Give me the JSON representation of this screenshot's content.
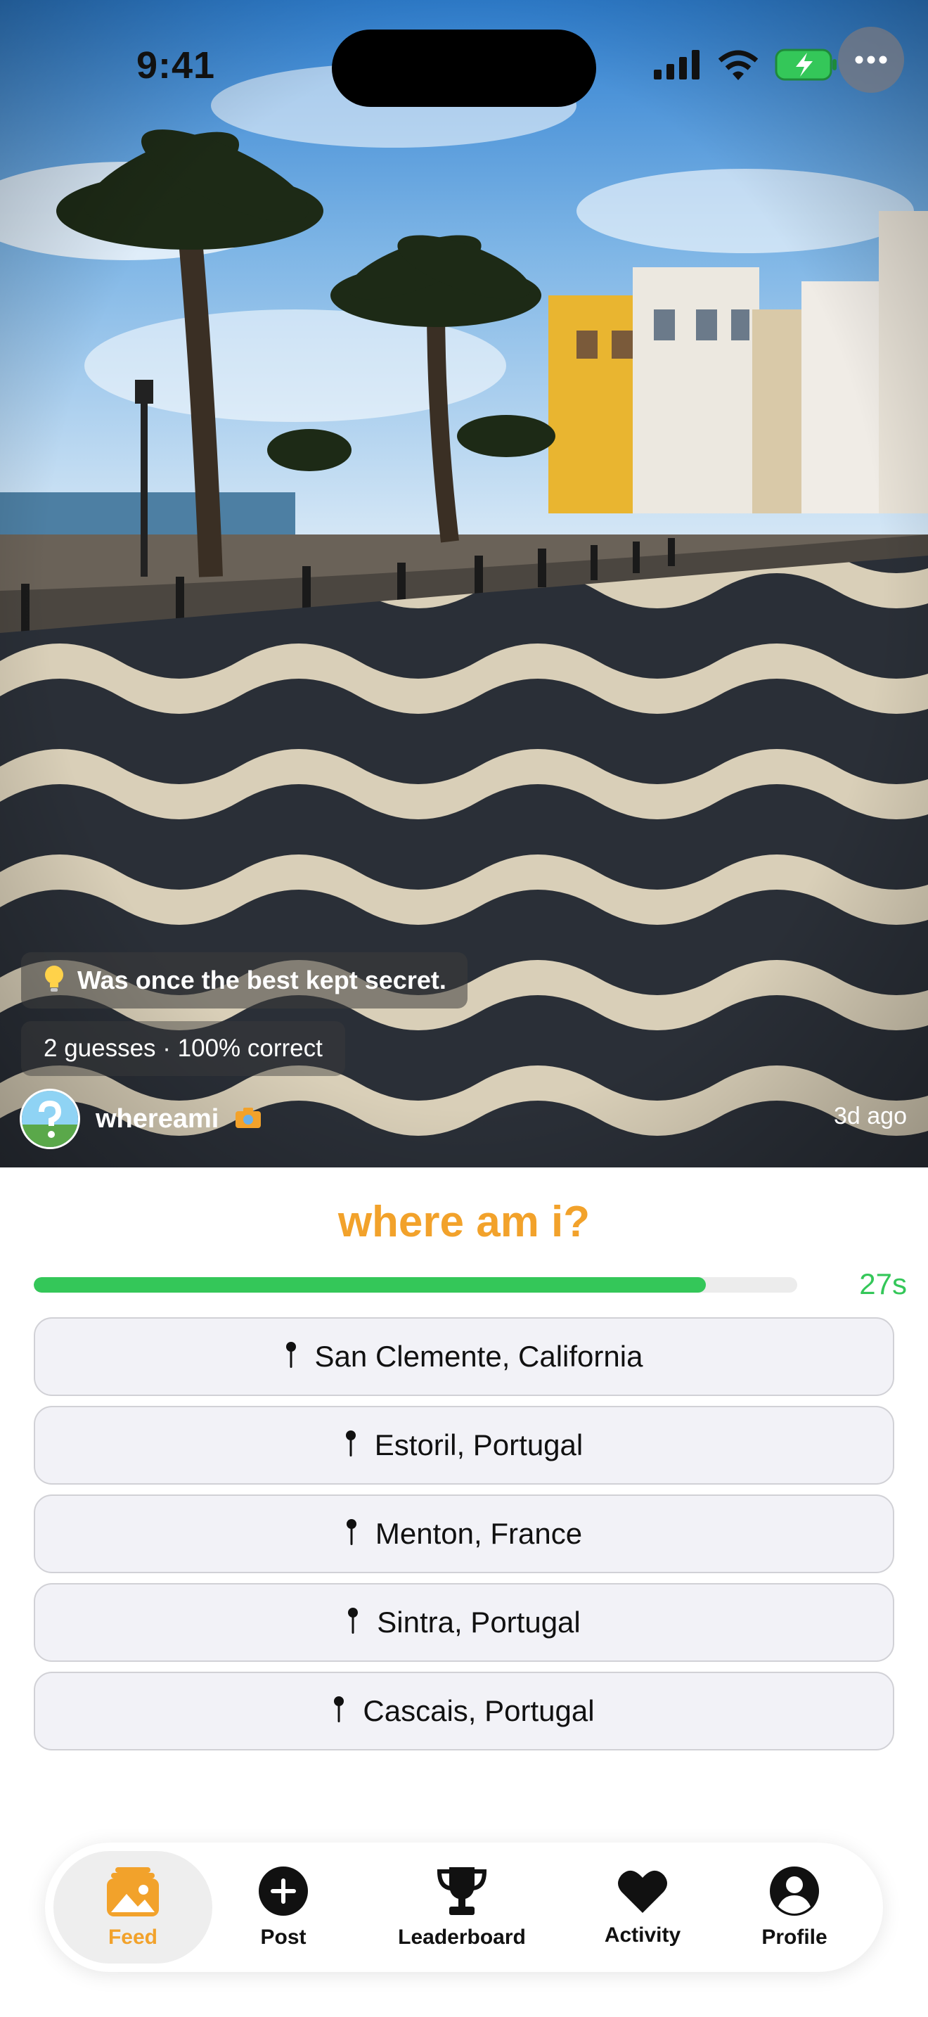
{
  "status_bar": {
    "time": "9:41"
  },
  "post": {
    "hint_icon": "lightbulb-icon",
    "hint": "Was once the best kept secret.",
    "stats": "2 guesses · 100% correct",
    "username": "whereami",
    "badge_icon": "camera-icon",
    "posted_ago": "3d ago"
  },
  "game": {
    "title": "where am i?",
    "timer_label": "27s",
    "timer_fraction": 0.88,
    "options": [
      {
        "label": "San Clemente, California",
        "icon": "pin-icon"
      },
      {
        "label": "Estoril, Portugal",
        "icon": "pin-icon"
      },
      {
        "label": "Menton, France",
        "icon": "pin-icon"
      },
      {
        "label": "Sintra, Portugal",
        "icon": "pin-icon"
      },
      {
        "label": "Cascais, Portugal",
        "icon": "pin-icon"
      }
    ]
  },
  "tabs": [
    {
      "label": "Feed",
      "icon": "photo-icon",
      "active": true
    },
    {
      "label": "Post",
      "icon": "plus-circle-icon",
      "active": false
    },
    {
      "label": "Leaderboard",
      "icon": "trophy-icon",
      "active": false
    },
    {
      "label": "Activity",
      "icon": "heart-icon",
      "active": false
    },
    {
      "label": "Profile",
      "icon": "person-circle-icon",
      "active": false
    }
  ],
  "colors": {
    "accent": "#F2A22B",
    "timer_green": "#34C759",
    "option_bg": "#F2F2F7",
    "option_border": "#D1D1D6"
  }
}
